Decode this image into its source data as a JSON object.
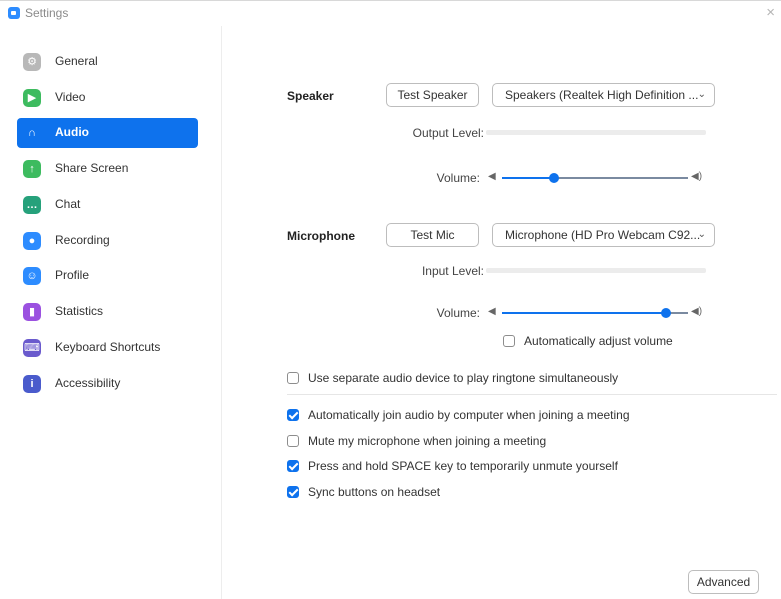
{
  "window": {
    "title": "Settings",
    "close_glyph": "×"
  },
  "sidebar": {
    "items": [
      {
        "label": "General",
        "icon": "gear-icon",
        "color": "#b8b8b8",
        "glyph": "⚙"
      },
      {
        "label": "Video",
        "icon": "video-camera-icon",
        "color": "#3dbb5f",
        "glyph": "▶"
      },
      {
        "label": "Audio",
        "icon": "headphones-icon",
        "color": "#0e72ed",
        "glyph": "∩",
        "active": true
      },
      {
        "label": "Share Screen",
        "icon": "share-screen-icon",
        "color": "#3dbb5f",
        "glyph": "↑"
      },
      {
        "label": "Chat",
        "icon": "chat-icon",
        "color": "#26a17b",
        "glyph": "…"
      },
      {
        "label": "Recording",
        "icon": "recording-icon",
        "color": "#2d8cff",
        "glyph": "●"
      },
      {
        "label": "Profile",
        "icon": "profile-icon",
        "color": "#2d8cff",
        "glyph": "☺"
      },
      {
        "label": "Statistics",
        "icon": "statistics-icon",
        "color": "#9b51e0",
        "glyph": "▮"
      },
      {
        "label": "Keyboard Shortcuts",
        "icon": "keyboard-icon",
        "color": "#6a5acd",
        "glyph": "⌨"
      },
      {
        "label": "Accessibility",
        "icon": "accessibility-icon",
        "color": "#4a5bcc",
        "glyph": "i"
      }
    ]
  },
  "speaker": {
    "section_label": "Speaker",
    "test_button": "Test Speaker",
    "device": "Speakers (Realtek High Definition ...",
    "output_level_label": "Output Level:",
    "volume_label": "Volume:",
    "volume": 0.28
  },
  "microphone": {
    "section_label": "Microphone",
    "test_button": "Test Mic",
    "device": "Microphone (HD Pro Webcam C92...",
    "input_level_label": "Input Level:",
    "volume_label": "Volume:",
    "volume": 0.88,
    "auto_adjust_label": "Automatically adjust volume",
    "auto_adjust_checked": false
  },
  "options": [
    {
      "label": "Use separate audio device to play ringtone simultaneously",
      "checked": false
    },
    {
      "label": "Automatically join audio by computer when joining a meeting",
      "checked": true
    },
    {
      "label": "Mute my microphone when joining a meeting",
      "checked": false
    },
    {
      "label": "Press and hold SPACE key to temporarily unmute yourself",
      "checked": true
    },
    {
      "label": "Sync buttons on headset",
      "checked": true
    }
  ],
  "advanced_button": "Advanced",
  "colors": {
    "accent": "#0e72ed"
  }
}
